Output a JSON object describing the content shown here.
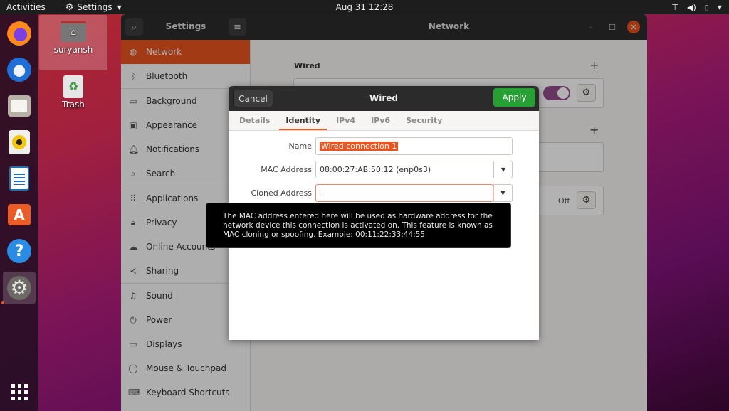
{
  "topbar": {
    "activities": "Activities",
    "app_menu": "Settings",
    "clock": "Aug 31  12:28",
    "tray_icons": [
      "network-wired-icon",
      "volume-icon",
      "battery-icon",
      "system-menu-caret-icon"
    ]
  },
  "dock": {
    "items": [
      {
        "name": "Firefox",
        "icon": "firefox-icon"
      },
      {
        "name": "Thunderbird",
        "icon": "thunderbird-icon"
      },
      {
        "name": "Files",
        "icon": "files-icon"
      },
      {
        "name": "Rhythmbox",
        "icon": "rhythmbox-icon"
      },
      {
        "name": "LibreOffice Writer",
        "icon": "writer-icon"
      },
      {
        "name": "Ubuntu Software",
        "icon": "software-store-icon"
      },
      {
        "name": "Help",
        "icon": "help-icon"
      },
      {
        "name": "Settings",
        "icon": "settings-icon",
        "active": true
      }
    ],
    "show_apps_icon": "app-grid-icon"
  },
  "desktop": {
    "items": [
      {
        "label": "suryansh",
        "icon": "home-folder-icon"
      },
      {
        "label": "Trash",
        "icon": "trash-icon"
      }
    ]
  },
  "settings_window": {
    "sidebar_title": "Settings",
    "panel_title": "Network",
    "sidebar": [
      {
        "label": "Network",
        "icon": "network-icon",
        "glyph": "◍",
        "selected": true
      },
      {
        "label": "Bluetooth",
        "icon": "bluetooth-icon",
        "glyph": "ᛒ"
      },
      {
        "label": "Background",
        "icon": "background-icon",
        "glyph": "▭"
      },
      {
        "label": "Appearance",
        "icon": "appearance-icon",
        "glyph": "▣"
      },
      {
        "label": "Notifications",
        "icon": "notifications-icon",
        "glyph": "♫"
      },
      {
        "label": "Search",
        "icon": "search-icon",
        "glyph": "⌕"
      },
      {
        "label": "Applications",
        "icon": "applications-icon",
        "glyph": "⠿"
      },
      {
        "label": "Privacy",
        "icon": "privacy-icon",
        "glyph": "🔒︎"
      },
      {
        "label": "Online Accounts",
        "icon": "cloud-icon",
        "glyph": "☁"
      },
      {
        "label": "Sharing",
        "icon": "sharing-icon",
        "glyph": "≺"
      },
      {
        "label": "Sound",
        "icon": "sound-icon",
        "glyph": "♫"
      },
      {
        "label": "Power",
        "icon": "power-icon",
        "glyph": "⏻"
      },
      {
        "label": "Displays",
        "icon": "displays-icon",
        "glyph": "▭"
      },
      {
        "label": "Mouse & Touchpad",
        "icon": "mouse-icon",
        "glyph": "◯"
      },
      {
        "label": "Keyboard Shortcuts",
        "icon": "keyboard-icon",
        "glyph": "⌨"
      }
    ],
    "content": {
      "wired_section_title": "Wired",
      "wired_toggle_on": true,
      "proxy_status": "Off"
    }
  },
  "dialog": {
    "title": "Wired",
    "cancel_label": "Cancel",
    "apply_label": "Apply",
    "tabs": [
      "Details",
      "Identity",
      "IPv4",
      "IPv6",
      "Security"
    ],
    "active_tab": "Identity",
    "fields": {
      "name_label": "Name",
      "name_value": "Wired connection 1",
      "mac_label": "MAC Address",
      "mac_value": "08:00:27:AB:50:12 (enp0s3)",
      "cloned_label": "Cloned Address",
      "cloned_value": ""
    },
    "tooltip": "The MAC address entered here will be used as hardware address for the network device this connection is activated on. This feature is known as MAC cloning or spoofing. Example: 00:11:22:33:44:55"
  },
  "colors": {
    "accent": "#e95420",
    "apply_green": "#26a032",
    "toggle_purple": "#924d8b",
    "header_dark": "#2b2b2b"
  }
}
